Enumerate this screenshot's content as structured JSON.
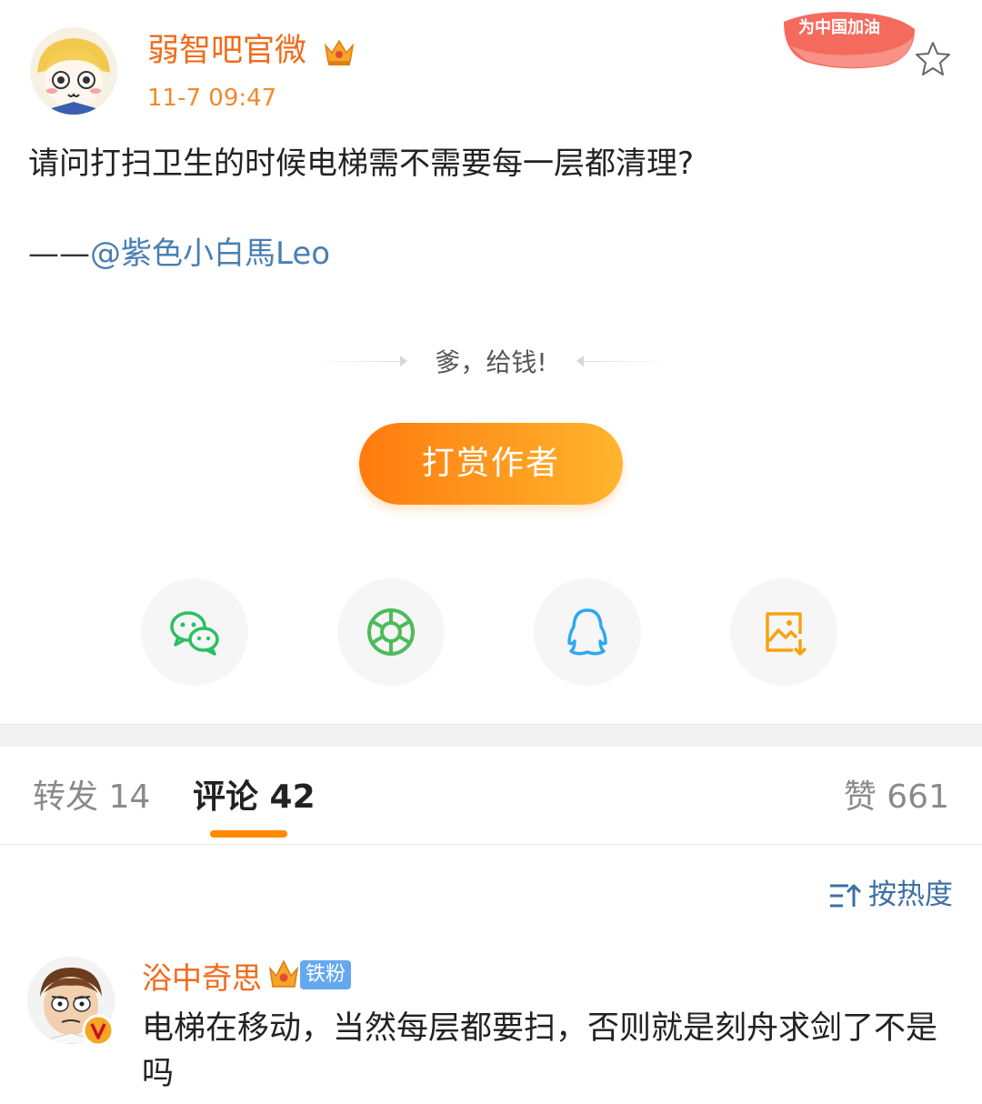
{
  "post": {
    "author": "弱智吧官微",
    "time": "11-7 09:47",
    "badge_text": "为中国加油",
    "text": "请问打扫卫生的时候电梯需不需要每一层都清理?",
    "credit_dash": "——",
    "credit_mention": "@紫色小白馬Leo"
  },
  "reward": {
    "label": "爹，给钱!",
    "button": "打赏作者"
  },
  "share_icons": [
    "wechat-icon",
    "moments-icon",
    "qq-icon",
    "save-image-icon"
  ],
  "tabs": {
    "repost": "转发 14",
    "comments": "评论 42",
    "likes": "赞 661"
  },
  "sort_label": "按热度",
  "comment": {
    "user": "浴中奇思",
    "fan_tag": "铁粉",
    "text": "电梯在移动，当然每层都要扫，否则就是刻舟求剑了不是吗"
  },
  "colors": {
    "name_orange": "#ef6b1a",
    "link_blue": "#4a7fb3",
    "button_start": "#ff7b0e",
    "button_end": "#ffb52e"
  }
}
